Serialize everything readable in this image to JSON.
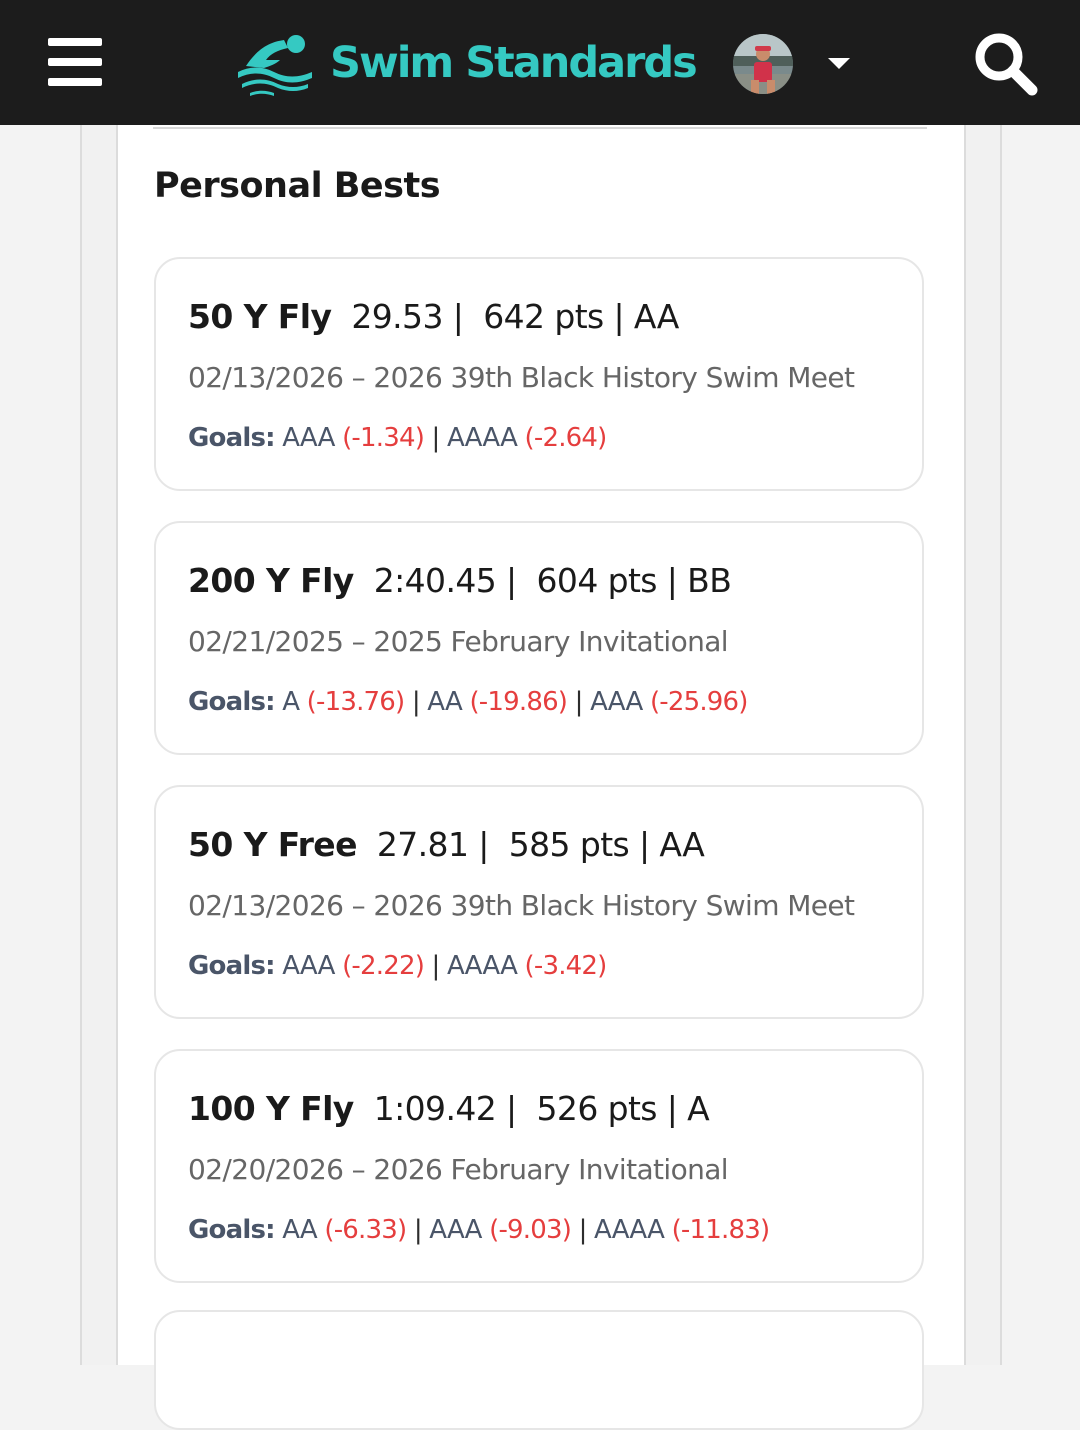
{
  "header": {
    "brand": "Swim Standards",
    "brand_color": "#35c9c2",
    "menu_icon": "hamburger-menu-icon",
    "search_icon": "search-icon"
  },
  "section": {
    "title": "Personal Bests"
  },
  "cards": [
    {
      "event": "50 Y Fly",
      "time": "29.53 |",
      "points": "642 pts | AA",
      "meet": "02/13/2026 – 2026 39th Black History Swim Meet",
      "goals_label": "Goals:",
      "goals": [
        {
          "level": "AAA",
          "diff": "(-1.34)"
        },
        {
          "level": "AAAA",
          "diff": "(-2.64)"
        }
      ]
    },
    {
      "event": "200 Y Fly",
      "time": "2:40.45 |",
      "points": "604 pts | BB",
      "meet": "02/21/2025 – 2025 February Invitational",
      "goals_label": "Goals:",
      "goals": [
        {
          "level": "A",
          "diff": "(-13.76)"
        },
        {
          "level": "AA",
          "diff": "(-19.86)"
        },
        {
          "level": "AAA",
          "diff": "(-25.96)"
        }
      ]
    },
    {
      "event": "50 Y Free",
      "time": "27.81 |",
      "points": "585 pts | AA",
      "meet": "02/13/2026 – 2026 39th Black History Swim Meet",
      "goals_label": "Goals:",
      "goals": [
        {
          "level": "AAA",
          "diff": "(-2.22)"
        },
        {
          "level": "AAAA",
          "diff": "(-3.42)"
        }
      ]
    },
    {
      "event": "100 Y Fly",
      "time": "1:09.42 |",
      "points": "526 pts | A",
      "meet": "02/20/2026 – 2026 February Invitational",
      "goals_label": "Goals:",
      "goals": [
        {
          "level": "AA",
          "diff": "(-6.33)"
        },
        {
          "level": "AAA",
          "diff": "(-9.03)"
        },
        {
          "level": "AAAA",
          "diff": "(-11.83)"
        }
      ]
    }
  ]
}
